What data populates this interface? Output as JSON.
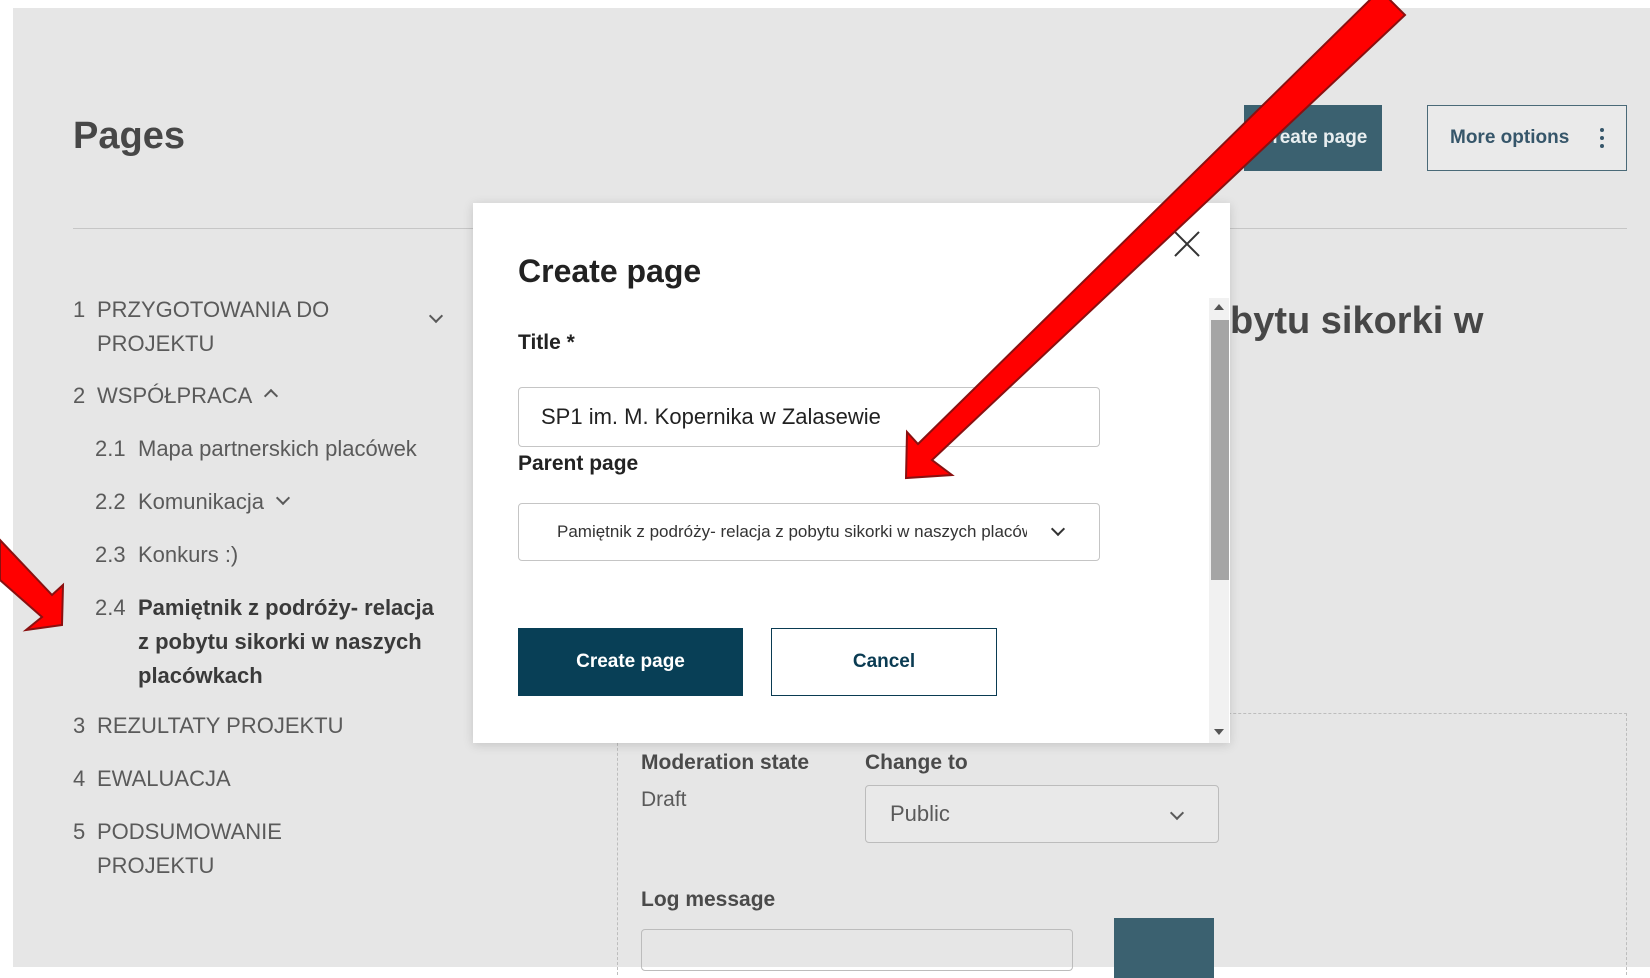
{
  "page": {
    "title": "Pages",
    "create_button": "Create page",
    "more_options_button": "More options"
  },
  "nav": {
    "items": [
      {
        "num": "1",
        "label": "PRZYGOTOWANIA DO PROJEKTU",
        "line1": "PRZYGOTOWANIA DO",
        "line2": "PROJEKTU"
      },
      {
        "num": "2",
        "label": "WSPÓŁPRACA"
      },
      {
        "num": "2.1",
        "label": "Mapa partnerskich placówek"
      },
      {
        "num": "2.2",
        "label": "Komunikacja"
      },
      {
        "num": "2.3",
        "label": "Konkurs :)"
      },
      {
        "num": "2.4",
        "label": "Pamiętnik z podróży- relacja z pobytu sikorki w naszych placówkach",
        "line1": "Pamiętnik z podróży- relacja",
        "line2": "z pobytu sikorki w naszych",
        "line3": "placówkach"
      },
      {
        "num": "3",
        "label": "REZULTATY PROJEKTU"
      },
      {
        "num": "4",
        "label": "EWALUACJA"
      },
      {
        "num": "5",
        "label": "PODSUMOWANIE PROJEKTU",
        "line1": "PODSUMOWANIE",
        "line2": "PROJEKTU"
      }
    ]
  },
  "background": {
    "heading_fragment": "bytu sikorki w",
    "moderation_label": "Moderation state",
    "moderation_value": "Draft",
    "change_to_label": "Change to",
    "change_to_value": "Public",
    "log_message_label": "Log message"
  },
  "modal": {
    "title": "Create page",
    "title_field_label": "Title *",
    "title_field_value": "SP1 im. M. Kopernika w Zalasewie",
    "parent_label": "Parent page",
    "parent_value": "Pamiętnik z podróży- relacja z pobytu sikorki w naszych placówkach",
    "submit_label": "Create page",
    "cancel_label": "Cancel"
  },
  "annotation_color": "#ff0000",
  "accent_colors": {
    "primary": "#083f56",
    "secondary": "#3b6170"
  }
}
